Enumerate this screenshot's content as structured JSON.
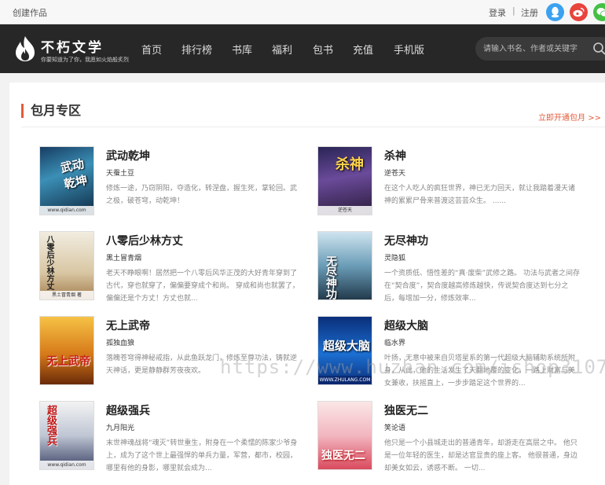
{
  "topbar": {
    "create_label": "创建作品",
    "login_label": "登录",
    "separator": "|",
    "register_label": "注册",
    "social": [
      "qq-icon",
      "weibo-icon",
      "wechat-icon"
    ]
  },
  "brand": {
    "name": "不朽文学",
    "slogan": "你要知道为了你，我愿如火焰般炙烈"
  },
  "nav": {
    "items": [
      "首页",
      "排行榜",
      "书库",
      "福利",
      "包书",
      "充值",
      "手机版"
    ]
  },
  "search": {
    "placeholder": "请输入书名、作者或关键字"
  },
  "section": {
    "title": "包月专区",
    "link_label": "立即开通包月 >>"
  },
  "books": [
    {
      "title": "武动乾坤",
      "author": "天蚕土豆",
      "desc": "修炼一途，乃窃阴阳，夺造化，转涅盘，握生死，掌轮回。武之极，破苍穹，动乾坤！",
      "cover_text": "武动乾坤",
      "cover_foot": "www.qidian.com"
    },
    {
      "title": "杀神",
      "author": "逆苍天",
      "desc": "在这个人吃人的疯狂世界，神已无力回天，就让我踏着漫天诸神的累累尸骨来普渡这芸芸众生。 ......",
      "cover_text": "杀神",
      "cover_foot": "逆苍天"
    },
    {
      "title": "八零后少林方丈",
      "author": "黑土冒青烟",
      "desc": "老天不睁眼啊！居然把一个八零后风华正茂的大好青年穿到了古代，穿也就穿了，偏偏要穿成个和尚。 穿成和尚也就罢了，偏偏还是个方丈！方丈也就...",
      "cover_text": "八零后少林方丈",
      "cover_foot": "黑土冒青烟 著"
    },
    {
      "title": "无尽神功",
      "author": "灵隐狐",
      "desc": "一个资质低、悟性差的“真·废柴”武修之路。 功法与武者之间存在“契合度”，契合度越高修炼越快，传说契合度达到七分之后，每增加一分，修炼效率...",
      "cover_text": "无尽神功",
      "cover_foot": ""
    },
    {
      "title": "无上武帝",
      "author": "孤独血狼",
      "desc": "落魄苍穹得神秘戒指，从此鱼跃龙门，修炼至尊功法，铸就逆天神话，更是静静群芳夜夜欢。",
      "cover_text": "无上武帝",
      "cover_foot": ""
    },
    {
      "title": "超级大脑",
      "author": "临水界",
      "desc": "叶扬，无意中被来自贝塔星系的第一代超级大脑辅助系统所附身，从此，他的生活发生了天翻地覆的变化，一路上财富与美女兼收，扶摇直上，一步步踏足这个世界的...",
      "cover_text": "超级大脑",
      "cover_foot": "WWW.ZHULANG.COM"
    },
    {
      "title": "超级强兵",
      "author": "九月阳光",
      "desc": "末世神魂战将“魂灭”转世重生，附身在一个柔懦的陈家少爷身上，成为了这个世上最强悍的单兵力量，军营，都市，校园，哪里有他的身影，哪里就会成为...",
      "cover_text": "超级强兵",
      "cover_foot": "www.qidian.com"
    },
    {
      "title": "独医无二",
      "author": "笑论语",
      "desc": "他只是一个小县城走出的普通青年，却游走在高层之中。 他只是一位年轻的医生，却是达官显贵的座上客。 他很普通，身边却美女如云，诱惑不断。 一切...",
      "cover_text": "独医无二",
      "cover_foot": ""
    }
  ],
  "watermark": "https://www.huzhan.com/ishop31073",
  "colors": {
    "accent": "#e35b3a",
    "navbar": "#272727",
    "page_bg": "#f2f2f2"
  }
}
